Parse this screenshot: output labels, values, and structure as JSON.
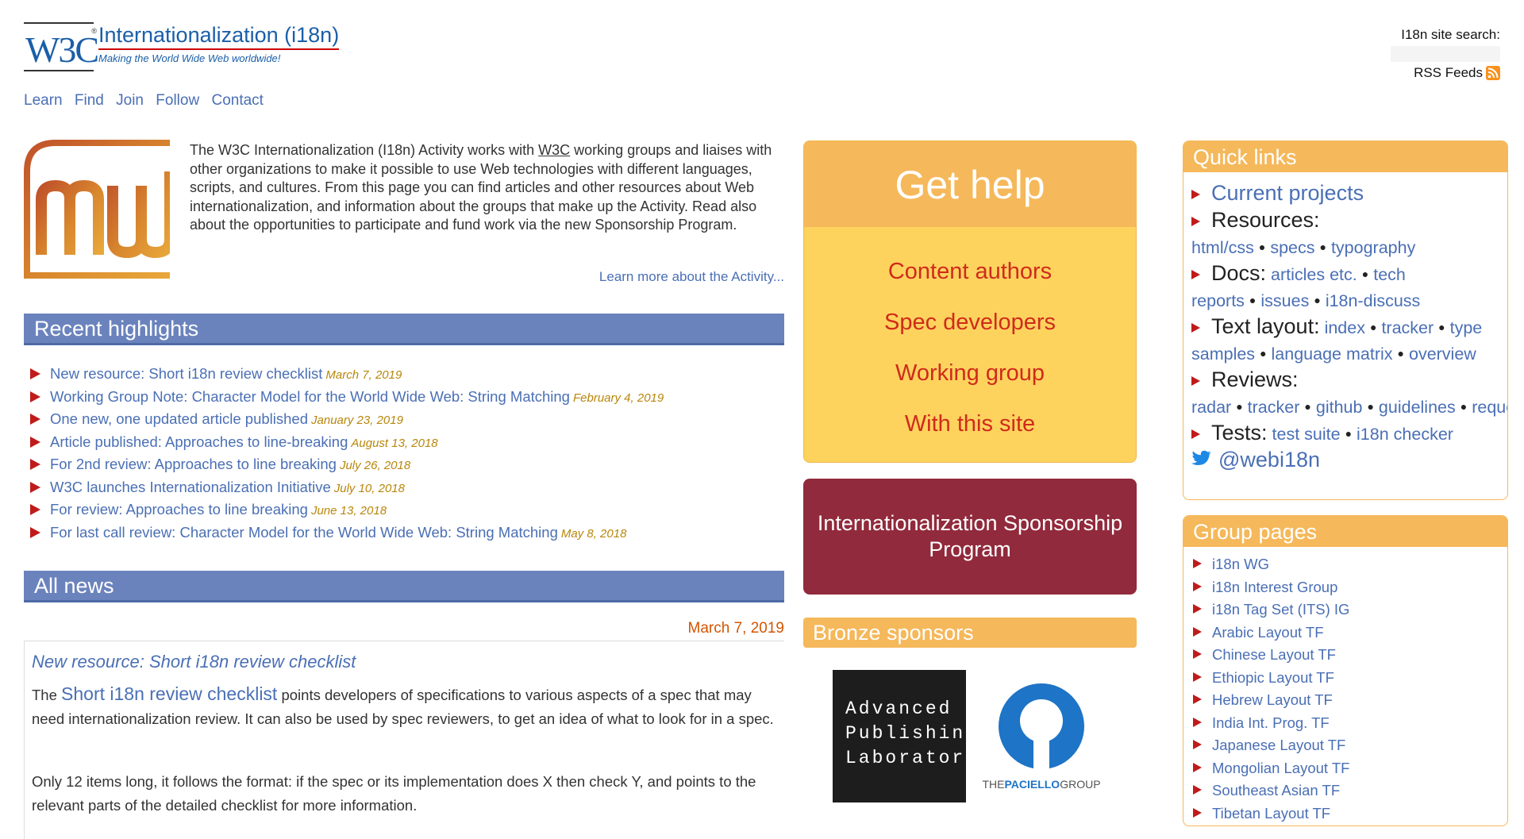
{
  "header": {
    "logo_text": "W3C",
    "logo_reg": "®",
    "site_title": "Internationalization (i18n)",
    "tagline": "Making the World Wide Web worldwide!",
    "search_label": "I18n site search:",
    "search_placeholder": "",
    "rss_label": "RSS Feeds"
  },
  "nav": {
    "items": [
      "Learn",
      "Find",
      "Join",
      "Follow",
      "Contact"
    ]
  },
  "intro": {
    "part1": "The W3C Internationalization (I18n) Activity works with ",
    "w3c_link": "W3C",
    "part2": " working groups and liaises with other organizations to make it possible to use Web technologies with different languages, scripts, and cultures. From this page you can find articles and other resources about Web internationalization, and information about the groups that make up the Activity. Read also about the opportunities to participate and fund work via the new Sponsorship Program.",
    "learn_more": "Learn more about the Activity..."
  },
  "recent": {
    "title": "Recent highlights",
    "items": [
      {
        "text": "New resource: Short i18n review checklist",
        "date": "March 7, 2019"
      },
      {
        "text": "Working Group Note: Character Model for the World Wide Web: String Matching",
        "date": "February 4, 2019"
      },
      {
        "text": "One new, one updated article published",
        "date": "January 23, 2019"
      },
      {
        "text": "Article published: Approaches to line-breaking",
        "date": "August 13, 2018"
      },
      {
        "text": "For 2nd review: Approaches to line breaking",
        "date": "July 26, 2018"
      },
      {
        "text": "W3C launches Internationalization Initiative",
        "date": "July 10, 2018"
      },
      {
        "text": "For review: Approaches to line breaking",
        "date": "June 13, 2018"
      },
      {
        "text": "For last call review: Character Model for the World Wide Web: String Matching",
        "date": "May 8, 2018"
      }
    ]
  },
  "news": {
    "title": "All news",
    "date": "March 7, 2019",
    "headline": "New resource: Short i18n review checklist",
    "p1_start": "The ",
    "p1_link": "Short i18n review checklist",
    "p1_rest": " points developers of specifications to various aspects of a spec that may need internationalization review. It can also be used by spec reviewers, to get an idea of what to look for in a spec.",
    "p2": "Only 12 items long, it follows the format: if the spec or its implementation does X then check Y, and points to the relevant parts of the detailed checklist for more information."
  },
  "gethelp": {
    "title": "Get help",
    "items": [
      "Content authors",
      "Spec developers",
      "Working group",
      "With this site"
    ]
  },
  "sponsorship": {
    "label": "Internationalization Sponsorship Program"
  },
  "bronze": {
    "title": "Bronze sponsors",
    "apl_lines": [
      "Advanced",
      "Publishing",
      "Laboratory"
    ],
    "tpg_prefix": "THE",
    "tpg_bold": "PACIELLO",
    "tpg_suffix": "GROUP"
  },
  "quick": {
    "title": "Quick links",
    "current_projects": "Current projects",
    "resources_label": "Resources:",
    "resources": [
      "html/css",
      "specs",
      "typography"
    ],
    "docs_label": "Docs:",
    "docs": [
      "articles etc.",
      "tech reports",
      "issues",
      "i18n-discuss"
    ],
    "text_label": "Text layout:",
    "text": [
      "index",
      "tracker",
      "type samples",
      "language matrix",
      "overview"
    ],
    "reviews_label": "Reviews:",
    "reviews": [
      "radar",
      "tracker",
      "github",
      "guidelines",
      "request"
    ],
    "tests_label": "Tests:",
    "tests": [
      "test suite",
      "i18n checker"
    ],
    "twitter": "@webi18n"
  },
  "groups": {
    "title": "Group pages",
    "items": [
      "i18n WG",
      "i18n Interest Group",
      "i18n Tag Set (ITS) IG",
      "Arabic Layout TF",
      "Chinese Layout TF",
      "Ethiopic Layout TF",
      "Hebrew Layout TF",
      "India Int. Prog. TF",
      "Japanese Layout TF",
      "Mongolian Layout TF",
      "Southeast Asian TF",
      "Tibetan Layout TF"
    ]
  },
  "colors": {
    "accent_blue": "#6b83bd",
    "link": "#4a6fb5",
    "orange": "#f5b85a",
    "help_yellow": "#fdd35e",
    "sponsor_red": "#912a3c",
    "arrow_red": "#c01b1b"
  }
}
